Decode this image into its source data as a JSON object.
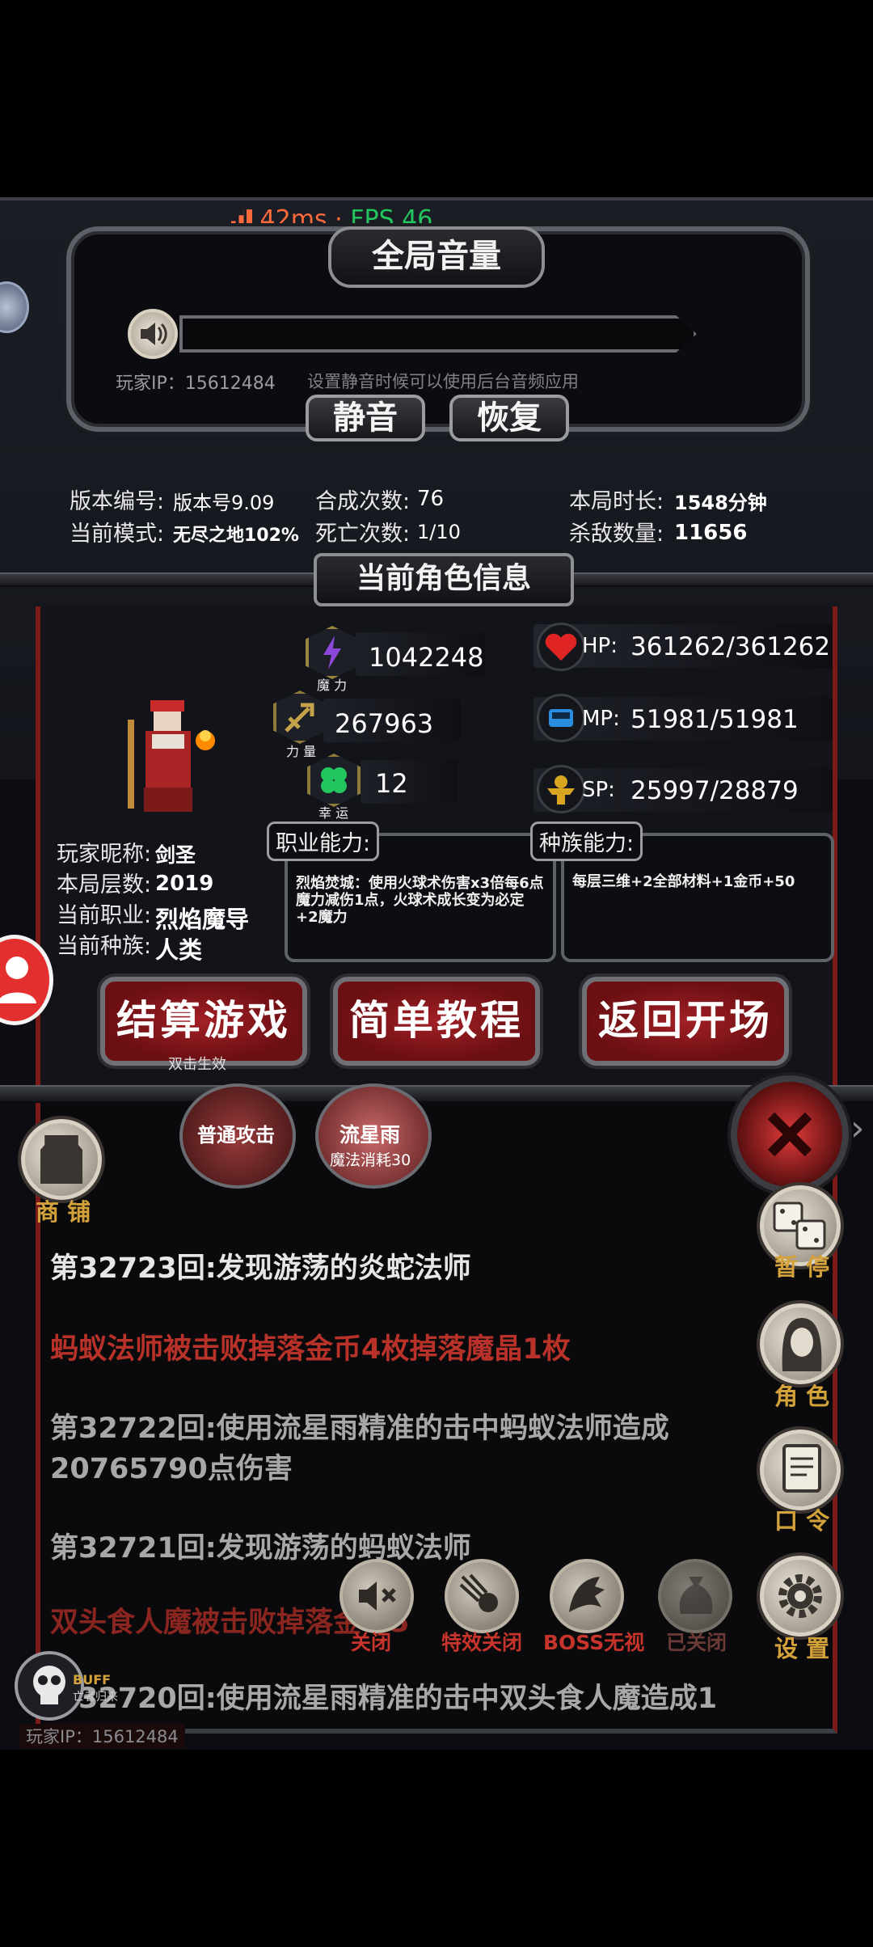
{
  "network": {
    "ping": "42ms",
    "separator": "·",
    "fps": "FPS 46"
  },
  "volume_panel": {
    "title": "全局音量",
    "hint": "设置静音时候可以使用后台音频应用",
    "player_ip": "玩家IP：15612484",
    "mute_button": "静音",
    "restore_button": "恢复"
  },
  "game_info": {
    "version_label": "版本编号:",
    "version_value": "版本号9.09",
    "merge_label": "合成次数:",
    "merge_value": "76",
    "duration_label": "本局时长:",
    "duration_value": "1548分钟",
    "mode_label": "当前模式:",
    "mode_value": "无尽之地102%",
    "death_label": "死亡次数:",
    "death_value": "1/10",
    "kills_label": "杀敌数量:",
    "kills_value": "11656"
  },
  "character": {
    "section_title": "当前角色信息",
    "magic_value": "1042248",
    "magic_label": "魔 力",
    "strength_value": "267963",
    "strength_label": "力 量",
    "luck_value": "12",
    "luck_label": "幸 运",
    "hp_label": "HP:",
    "hp_value": "361262/361262",
    "mp_label": "MP:",
    "mp_value": "51981/51981",
    "sp_label": "SP:",
    "sp_value": "25997/28879",
    "nickname_label": "玩家昵称:",
    "nickname_value": "剑圣",
    "floor_label": "本局层数:",
    "floor_value": "2019",
    "class_label": "当前职业:",
    "class_value": "烈焰魔导",
    "race_label": "当前种族:",
    "race_value": "人类",
    "class_ability_title": "职业能力:",
    "class_ability_text": "烈焰焚城：使用火球术伤害x3倍每6点魔力减伤1点，火球术成长变为必定+2魔力",
    "race_ability_title": "种族能力:",
    "race_ability_text": "每层三维+2全部材料+1金币+50"
  },
  "actions": {
    "settle_button": "结算游戏",
    "settle_hint": "双击生效",
    "tutorial_button": "简单教程",
    "return_button": "返回开场"
  },
  "skills": {
    "normal_attack": "普通攻击",
    "meteor": "流星雨",
    "meteor_cost": "魔法消耗30"
  },
  "side_menu": {
    "shop": "商 铺",
    "pause": "暂 停",
    "role": "角 色",
    "password": "口 令",
    "settings": "设 置"
  },
  "log": [
    {
      "text": "第32723回:发现游荡的炎蛇法师",
      "color": "#e6e6e6"
    },
    {
      "text": "蚂蚁法师被击败掉落金币4枚掉落魔晶1枚",
      "color": "#b8322a"
    },
    {
      "text": "第32722回:使用流星雨精准的击中蚂蚁法师造成20765790点伤害",
      "color": "#a8a8a8"
    },
    {
      "text": "第32721回:发现游荡的蚂蚁法师",
      "color": "#a8a8a8"
    },
    {
      "text": "双头食人魔被击败掉落金币5",
      "color": "#8a2520"
    },
    {
      "text": "第32720回:使用流星雨精准的击中双头食人魔造成1",
      "color": "#a8a8a8"
    }
  ],
  "bottom_toggles": {
    "sound_off": "关闭",
    "effects_off": "特效关闭",
    "boss_ignore": "BOSS无视",
    "closed": "已关闭"
  },
  "buff": {
    "label": "BUFF",
    "sub": "亡者归来"
  },
  "footer_ip": "玩家IP：15612484",
  "colors": {
    "accent_gold": "#d4a23a",
    "accent_red": "#c6342c",
    "ping_orange": "#ff6a3d",
    "fps_green": "#22c55e"
  }
}
